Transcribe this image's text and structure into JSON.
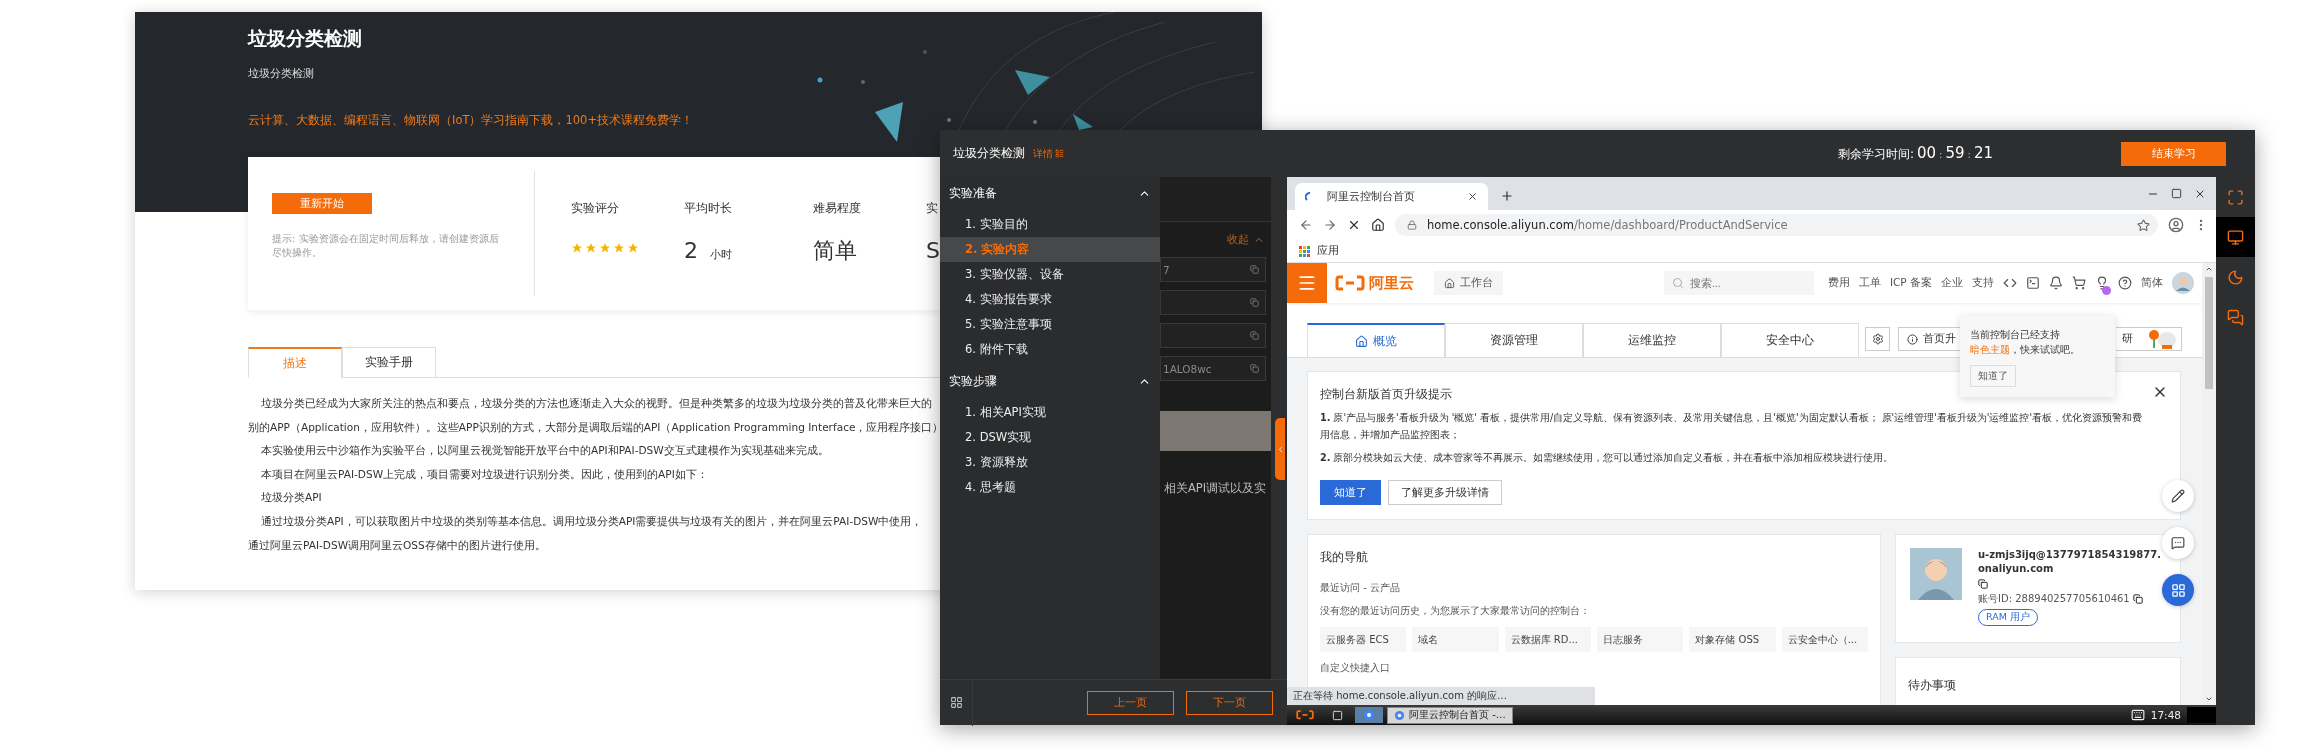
{
  "course": {
    "title": "垃圾分类检测",
    "subtitle": "垃圾分类检测",
    "promo": "云计算、大数据、编程语言、物联网（IoT）学习指南下载，100+技术课程免费学！",
    "restart_button": "重新开始",
    "hint": "提示: 实验资源会在固定时间后释放，请创建资源后尽快操作。",
    "stats": [
      {
        "kind": "stars",
        "label": "实验评分",
        "stars": 5
      },
      {
        "kind": "duration",
        "label": "平均时长",
        "value": "2",
        "unit": "小时"
      },
      {
        "kind": "text",
        "label": "难易程度",
        "value": "简单"
      },
      {
        "kind": "text",
        "label": "实",
        "value": "S"
      }
    ],
    "tabs": [
      {
        "label": "描述",
        "selected": true
      },
      {
        "label": "实验手册",
        "selected": false
      }
    ],
    "lines": [
      {
        "text": "垃圾分类已经成为大家所关注的热点和要点，垃圾分类的方法也逐渐走入大众的视野。但是种类繁多的垃圾为垃圾分类的普及化带来巨大的",
        "indent": true
      },
      {
        "text": "别的APP（Application，应用软件）。这些APP识别的方式，大部分是调取后端的API（Application Programming Interface，应用程序接口）",
        "indent": false
      },
      {
        "text": "本实验使用云中沙箱作为实验平台，以阿里云视觉智能开放平台中的API和PAI-DSW交互式建模作为实现基础来完成。",
        "indent": true
      },
      {
        "text": "本项目在阿里云PAI-DSW上完成，项目需要对垃圾进行识别分类。因此，使用到的API如下：",
        "indent": true
      },
      {
        "text": "垃圾分类API",
        "indent": true
      },
      {
        "text": "通过垃圾分类API，可以获取图片中垃圾的类别等基本信息。调用垃圾分类API需要提供与垃圾有关的图片，并在阿里云PAI-DSW中使用，",
        "indent": true
      },
      {
        "text": "通过阿里云PAI-DSW调用阿里云OSS存储中的图片进行使用。",
        "indent": false
      }
    ]
  },
  "lab": {
    "title": "垃圾分类检测",
    "details_link": "详情",
    "timer_label": "剩余学习时间:",
    "timer": [
      "00",
      "59",
      "21"
    ],
    "timer_separator": ":",
    "end_button": "结束学习",
    "sections": [
      {
        "title": "实验准备",
        "expanded": true,
        "items": [
          {
            "label": "1. 实验目的",
            "selected": false
          },
          {
            "label": "2. 实验内容",
            "selected": true
          },
          {
            "label": "3. 实验仪器、设备",
            "selected": false
          },
          {
            "label": "4. 实验报告要求",
            "selected": false
          },
          {
            "label": "5. 实验注意事项",
            "selected": false
          },
          {
            "label": "6. 附件下载",
            "selected": false
          }
        ]
      },
      {
        "title": "实验步骤",
        "expanded": true,
        "items": [
          {
            "label": "1. 相关API实现",
            "selected": false
          },
          {
            "label": "2. DSW实现",
            "selected": false
          },
          {
            "label": "3. 资源释放",
            "selected": false
          },
          {
            "label": "4. 思考题",
            "selected": false
          }
        ]
      }
    ],
    "prev_button": "上一页",
    "next_button": "下一页",
    "tools": [
      {
        "kind": "fullscreen",
        "selected": false
      },
      {
        "kind": "desktop",
        "selected": true
      },
      {
        "kind": "theme",
        "selected": false
      },
      {
        "kind": "chat",
        "selected": false
      }
    ],
    "behind": {
      "collapse_link": "收起",
      "fields": [
        {
          "kind": "text",
          "value": "7"
        },
        {
          "kind": "blank"
        },
        {
          "kind": "blank"
        },
        {
          "kind": "text",
          "value": "1ALO8wc"
        }
      ],
      "text": "相关API调试以及实"
    }
  },
  "browser": {
    "tab_title": "阿里云控制台首页",
    "loading": true,
    "url_host": "home.console.aliyun.com",
    "url_path": "/home/dashboard/ProductAndService",
    "bookmark": "应用",
    "console": {
      "logo": "阿里云",
      "workbench": "工作台",
      "search_placeholder": "搜索...",
      "links": [
        "费用",
        "工单",
        "ICP 备案",
        "企业",
        "支持"
      ],
      "language": "简体",
      "tabs": [
        {
          "label": "概览",
          "selected": true
        },
        {
          "label": "资源管理",
          "selected": false
        },
        {
          "label": "运维监控",
          "selected": false
        },
        {
          "label": "安全中心",
          "selected": false
        }
      ],
      "upgrade_button": "首页升",
      "survey_button": "研",
      "popover": {
        "before": "当前控制台已经支持 ",
        "link": "暗色主题",
        "after": "，快来试试吧。",
        "button": "知道了"
      },
      "notice": {
        "title": "控制台新版首页升级提示",
        "items": [
          "**1.** 原'产品与服务'看板升级为 '概览' 看板，提供常用/自定义导航、保有资源列表、及常用关键信息，且'概览'为固定默认看板； 原'运维管理'看板升级为'运维监控'看板，优化资源预警和费用信息，并增加产品监控图表；",
          "**2.** 原部分模块如云大使、成本管家等不再展示。如需继续使用，您可以通过添加自定义看板，并在看板中添加相应模块进行使用。"
        ],
        "primary_button": "知道了",
        "secondary_button": "了解更多升级详情"
      },
      "nav": {
        "title": "我的导航",
        "recent_label": "最近访问 - 云产品",
        "empty_text": "没有您的最近访问历史，为您展示了大家最常访问的控制台：",
        "chips": [
          "云服务器 ECS",
          "域名",
          "云数据库 RD...",
          "日志服务",
          "对象存储 OSS",
          "云安全中心（..."
        ],
        "custom_label": "自定义快捷入口"
      },
      "user": {
        "name": "u-zmjs3ijq@1377971854319877.onaliyun.com",
        "account_id": "账号ID: 288940257705610461",
        "tag": "RAM 用户"
      },
      "todo": {
        "title": "待办事项"
      }
    },
    "status_text": "正在等待 home.console.aliyun.com 的响应…",
    "taskbar": {
      "task": "阿里云控制台首页 -…",
      "time": "17:48"
    }
  }
}
